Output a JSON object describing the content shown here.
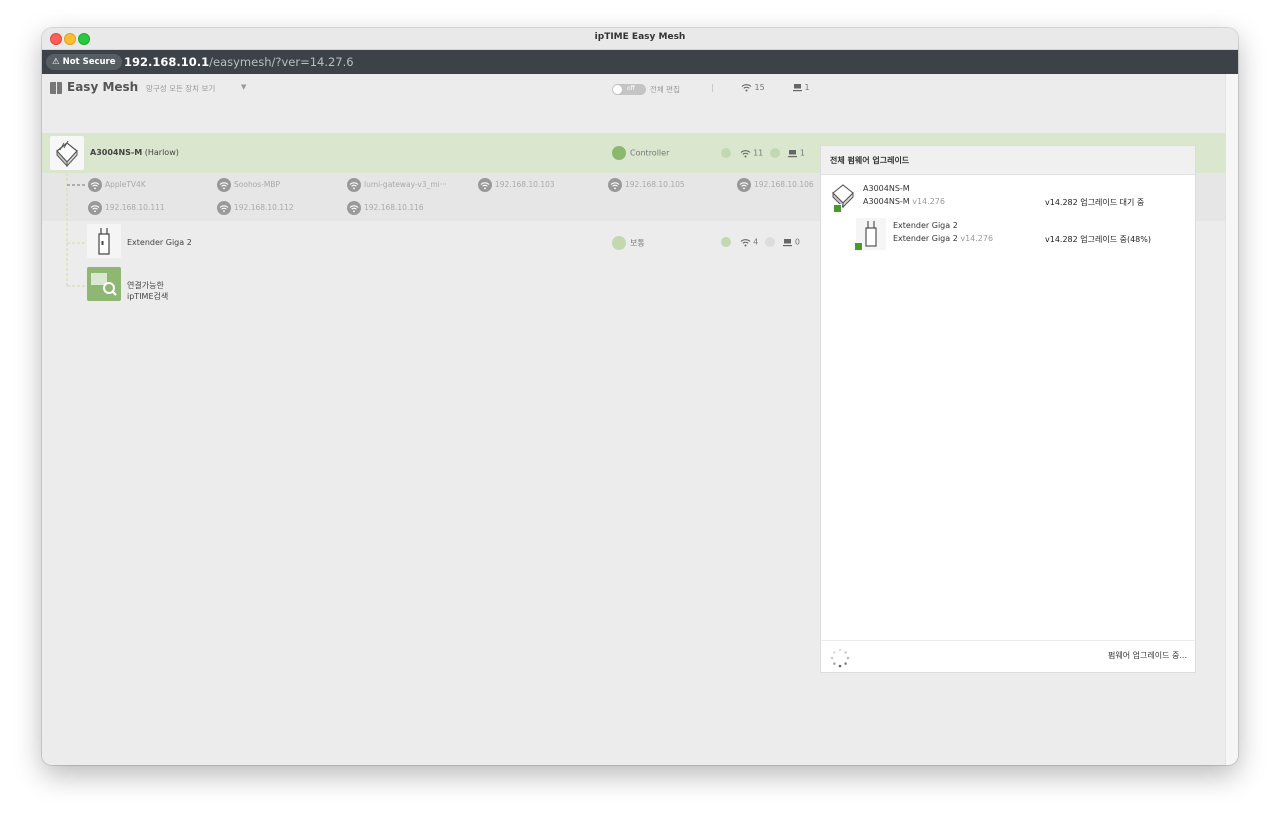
{
  "window": {
    "title": "ipTIME Easy Mesh"
  },
  "urlbar": {
    "security_label": "Not Secure",
    "host": "192.168.10.1",
    "path": "/easymesh/?ver=14.27.6"
  },
  "toolbar": {
    "app_title": "Easy Mesh",
    "separator": "|",
    "view_label": "망구성 모든 장치 보기",
    "view_caret": "▼",
    "toggle_label": "off",
    "edit_label": "전체 편집",
    "divider": "|",
    "wifi_count": "15",
    "wired_count": "1"
  },
  "controller": {
    "model": "A3004NS-M",
    "alias": "(Harlow)",
    "role": "Controller",
    "wifi_count": "11",
    "wired_count": "1"
  },
  "clients": [
    {
      "name": "AppleTV4K"
    },
    {
      "name": "Soohos-MBP"
    },
    {
      "name": "lumi-gateway-v3_mi···"
    },
    {
      "name": "192.168.10.103"
    },
    {
      "name": "192.168.10.105"
    },
    {
      "name": "192.168.10.106"
    },
    {
      "name": "192.168.10.111"
    },
    {
      "name": "192.168.10.112"
    },
    {
      "name": "192.168.10.116"
    }
  ],
  "extender": {
    "name": "Extender Giga 2",
    "signal_label": "보통",
    "wifi_count": "4",
    "wired_count": "0"
  },
  "search_tile": {
    "line1": "연결가능한",
    "line2": "ipTIME검색"
  },
  "panel": {
    "title": "전체 펌웨어 업그레이드",
    "items": [
      {
        "title": "A3004NS-M",
        "model": "A3004NS-M",
        "version": "v14.276",
        "status": "v14.282 업그레이드 대기 중"
      },
      {
        "title": "Extender Giga 2",
        "model": "Extender Giga 2",
        "version": "v14.276",
        "status": "v14.282 업그레이드 중(48%)"
      }
    ],
    "footer_status": "펌웨어 업그레이드 중..."
  },
  "colors": {
    "controller_row": "#dbe6cf",
    "accent_green": "#8ab96e",
    "url_bar": "#3c4247"
  }
}
